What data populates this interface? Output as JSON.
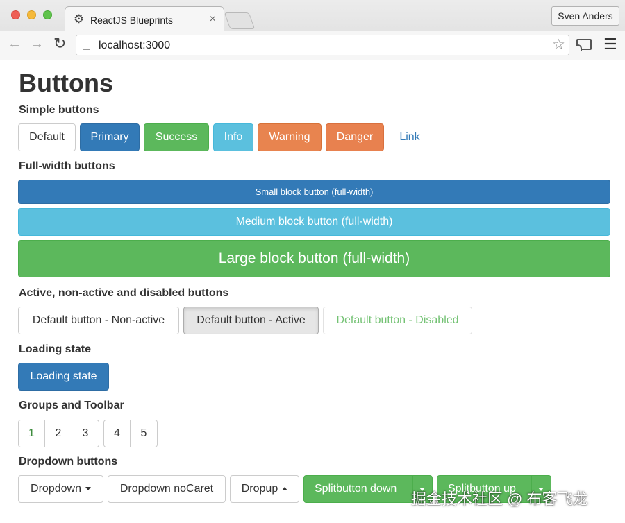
{
  "browser": {
    "tab_title": "ReactJS Blueprints",
    "tab_icon": "gear-icon",
    "tab_close": "×",
    "profile_name": "Sven Anders",
    "url": "localhost:3000"
  },
  "page": {
    "title": "Buttons",
    "sections": {
      "simple": "Simple buttons",
      "fullwidth": "Full-width buttons",
      "active": "Active, non-active and disabled buttons",
      "loading": "Loading state",
      "groups": "Groups and Toolbar",
      "dropdown": "Dropdown buttons"
    },
    "simple_buttons": {
      "default": "Default",
      "primary": "Primary",
      "success": "Success",
      "info": "Info",
      "warning": "Warning",
      "danger": "Danger",
      "link": "Link"
    },
    "block_buttons": {
      "small": "Small block button (full-width)",
      "medium": "Medium block button (full-width)",
      "large": "Large block button (full-width)"
    },
    "state_buttons": {
      "nonactive": "Default button - Non-active",
      "active": "Default button - Active",
      "disabled": "Default button - Disabled"
    },
    "loading_button": "Loading state",
    "group1": [
      "1",
      "2",
      "3"
    ],
    "group2": [
      "4",
      "5"
    ],
    "dropdown_buttons": {
      "dropdown": "Dropdown",
      "nocaret": "Dropdown noCaret",
      "dropup": "Dropup",
      "split_down": "Splitbutton down",
      "split_up": "Splitbutton up"
    }
  },
  "watermark": "掘金技术社区 @ 布客飞龙",
  "colors": {
    "primary": "#337ab7",
    "success": "#5cb85c",
    "info": "#5bc0de",
    "warning": "#e8844f",
    "danger": "#e8814f"
  }
}
